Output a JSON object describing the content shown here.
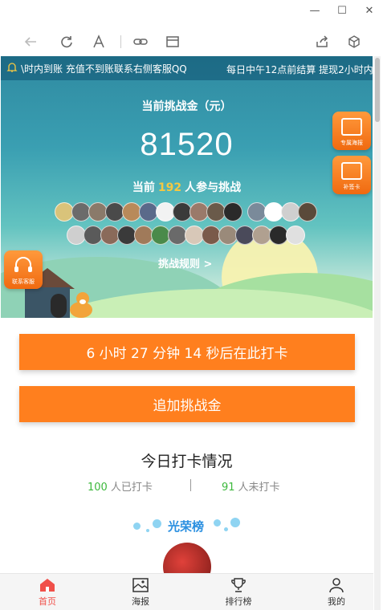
{
  "window": {
    "min": "—",
    "max": "☐",
    "close": "✕"
  },
  "marquee": {
    "left_text": "\\时内到账 充值不到账联系右侧客服QQ",
    "right_text": "每日中午12点前结算 提现2小时内"
  },
  "banner": {
    "challenge_label": "当前挑战金（元）",
    "amount": "81520",
    "participants_prefix": "当前",
    "participants_count": "192",
    "participants_suffix": "人参与挑战",
    "rules_link": "挑战规则 >",
    "poster_button": "专属海报",
    "checkin_button": "补签卡",
    "service_button": "联系客服"
  },
  "actions": {
    "checkin_countdown": "6 小时 27 分钟 14 秒后在此打卡",
    "add_challenge": "追加挑战金"
  },
  "today": {
    "title": "今日打卡情况",
    "checked_count": "100",
    "checked_label": "人已打卡",
    "unchecked_count": "91",
    "unchecked_label": "人未打卡"
  },
  "honor": {
    "title": "光荣榜"
  },
  "nav": {
    "items": [
      {
        "label": "首页",
        "icon": "home-icon",
        "active": true
      },
      {
        "label": "海报",
        "icon": "poster-icon",
        "active": false
      },
      {
        "label": "排行榜",
        "icon": "trophy-icon",
        "active": false
      },
      {
        "label": "我的",
        "icon": "user-icon",
        "active": false
      }
    ]
  },
  "colors": {
    "accent": "#ff7f1e",
    "active_nav": "#f0504a",
    "checked_green": "#3cb83c",
    "honor_blue": "#2a8fe0",
    "highlight_yellow": "#f5c842"
  }
}
